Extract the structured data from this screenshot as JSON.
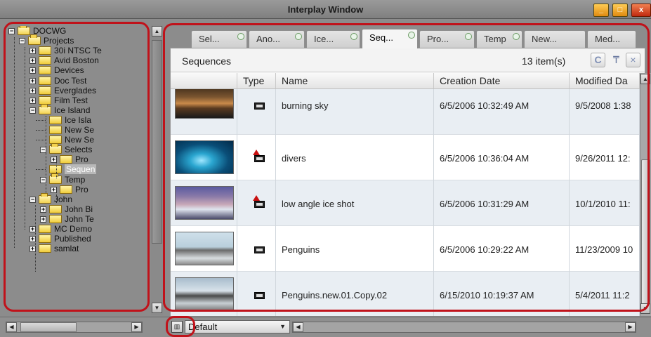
{
  "window": {
    "title": "Interplay Window",
    "buttons": {
      "minimize": "_",
      "maximize": "□",
      "close": "x"
    }
  },
  "tree": {
    "items": [
      {
        "label": "DOCWG",
        "expander": "−",
        "open": true
      },
      {
        "label": "Projects",
        "expander": "−",
        "open": true
      },
      {
        "label": "30i NTSC Te",
        "expander": "+"
      },
      {
        "label": "Avid Boston",
        "expander": "+"
      },
      {
        "label": "Devices",
        "expander": "+"
      },
      {
        "label": "Doc Test",
        "expander": "+"
      },
      {
        "label": "Everglades",
        "expander": "+"
      },
      {
        "label": "Film Test",
        "expander": "+"
      },
      {
        "label": "Ice Island",
        "expander": "−",
        "open": true
      },
      {
        "label": "Ice Isla",
        "expander": ""
      },
      {
        "label": "New Se",
        "expander": ""
      },
      {
        "label": "New Se",
        "expander": ""
      },
      {
        "label": "Selects",
        "expander": "−",
        "open": true
      },
      {
        "label": "Pro",
        "expander": "+"
      },
      {
        "label": "Sequen",
        "expander": "",
        "selected": true
      },
      {
        "label": "Temp",
        "expander": "−",
        "open": true
      },
      {
        "label": "Pro",
        "expander": "+"
      },
      {
        "label": "John",
        "expander": "−",
        "open": true
      },
      {
        "label": "John Bi",
        "expander": "+"
      },
      {
        "label": "John Te",
        "expander": "+"
      },
      {
        "label": "MC Demo",
        "expander": "+"
      },
      {
        "label": "Published",
        "expander": "+"
      },
      {
        "label": "samlat",
        "expander": "+"
      }
    ]
  },
  "tabs": [
    {
      "label": "Sel..."
    },
    {
      "label": "Ano..."
    },
    {
      "label": "Ice..."
    },
    {
      "label": "Seq...",
      "active": true
    },
    {
      "label": "Pro..."
    },
    {
      "label": "Temp"
    },
    {
      "label": "New..."
    },
    {
      "label": "Med..."
    }
  ],
  "pane": {
    "title": "Sequences",
    "item_count": "13 item(s)",
    "refresh_icon": "C",
    "pin_icon": "₸",
    "close_icon": "×"
  },
  "table": {
    "headers": {
      "thumb": "",
      "type": "Type",
      "name": "Name",
      "creation": "Creation Date",
      "modified": "Modified Da"
    },
    "rows": [
      {
        "name": "burning sky",
        "creation": "6/5/2006 10:32:49 AM",
        "modified": "9/5/2008 1:38",
        "type_icon": "sequence-icon",
        "thumb": "sky",
        "alt": true
      },
      {
        "name": "divers",
        "creation": "6/5/2006 10:36:04 AM",
        "modified": "9/26/2011 12:",
        "type_icon": "sequence-alert-icon",
        "thumb": "water",
        "alt": false
      },
      {
        "name": "low angle ice shot",
        "creation": "6/5/2006 10:31:29 AM",
        "modified": "10/1/2010 11:",
        "type_icon": "sequence-alert-icon",
        "thumb": "ice",
        "alt": true
      },
      {
        "name": "Penguins",
        "creation": "6/5/2006 10:29:22 AM",
        "modified": "11/23/2009 10",
        "type_icon": "sequence-icon",
        "thumb": "people",
        "alt": false
      },
      {
        "name": "Penguins.new.01.Copy.02",
        "creation": "6/15/2010 10:19:37 AM",
        "modified": "5/4/2011 11:2",
        "type_icon": "sequence-icon",
        "thumb": "people2",
        "alt": true
      }
    ]
  },
  "bottom": {
    "layout_value": "Default"
  },
  "colors": {
    "annotation": "#c0121a",
    "row_alt": "#e9eef3"
  }
}
